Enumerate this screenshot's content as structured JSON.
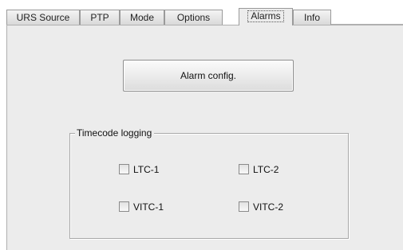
{
  "tabs": [
    {
      "label": "URS Source",
      "active": false
    },
    {
      "label": "PTP",
      "active": false
    },
    {
      "label": "Mode",
      "active": false
    },
    {
      "label": "Options",
      "active": false
    },
    {
      "label": "Alarms",
      "active": true
    },
    {
      "label": "Info",
      "active": false
    }
  ],
  "alarm_button": {
    "label": "Alarm config."
  },
  "timecode_logging": {
    "title": "Timecode logging",
    "options": [
      {
        "label": "LTC-1",
        "checked": false
      },
      {
        "label": "LTC-2",
        "checked": false
      },
      {
        "label": "VITC-1",
        "checked": false
      },
      {
        "label": "VITC-2",
        "checked": false
      }
    ]
  },
  "colors": {
    "panel_background": "#ececec",
    "tab_border": "#9a9a9a"
  }
}
